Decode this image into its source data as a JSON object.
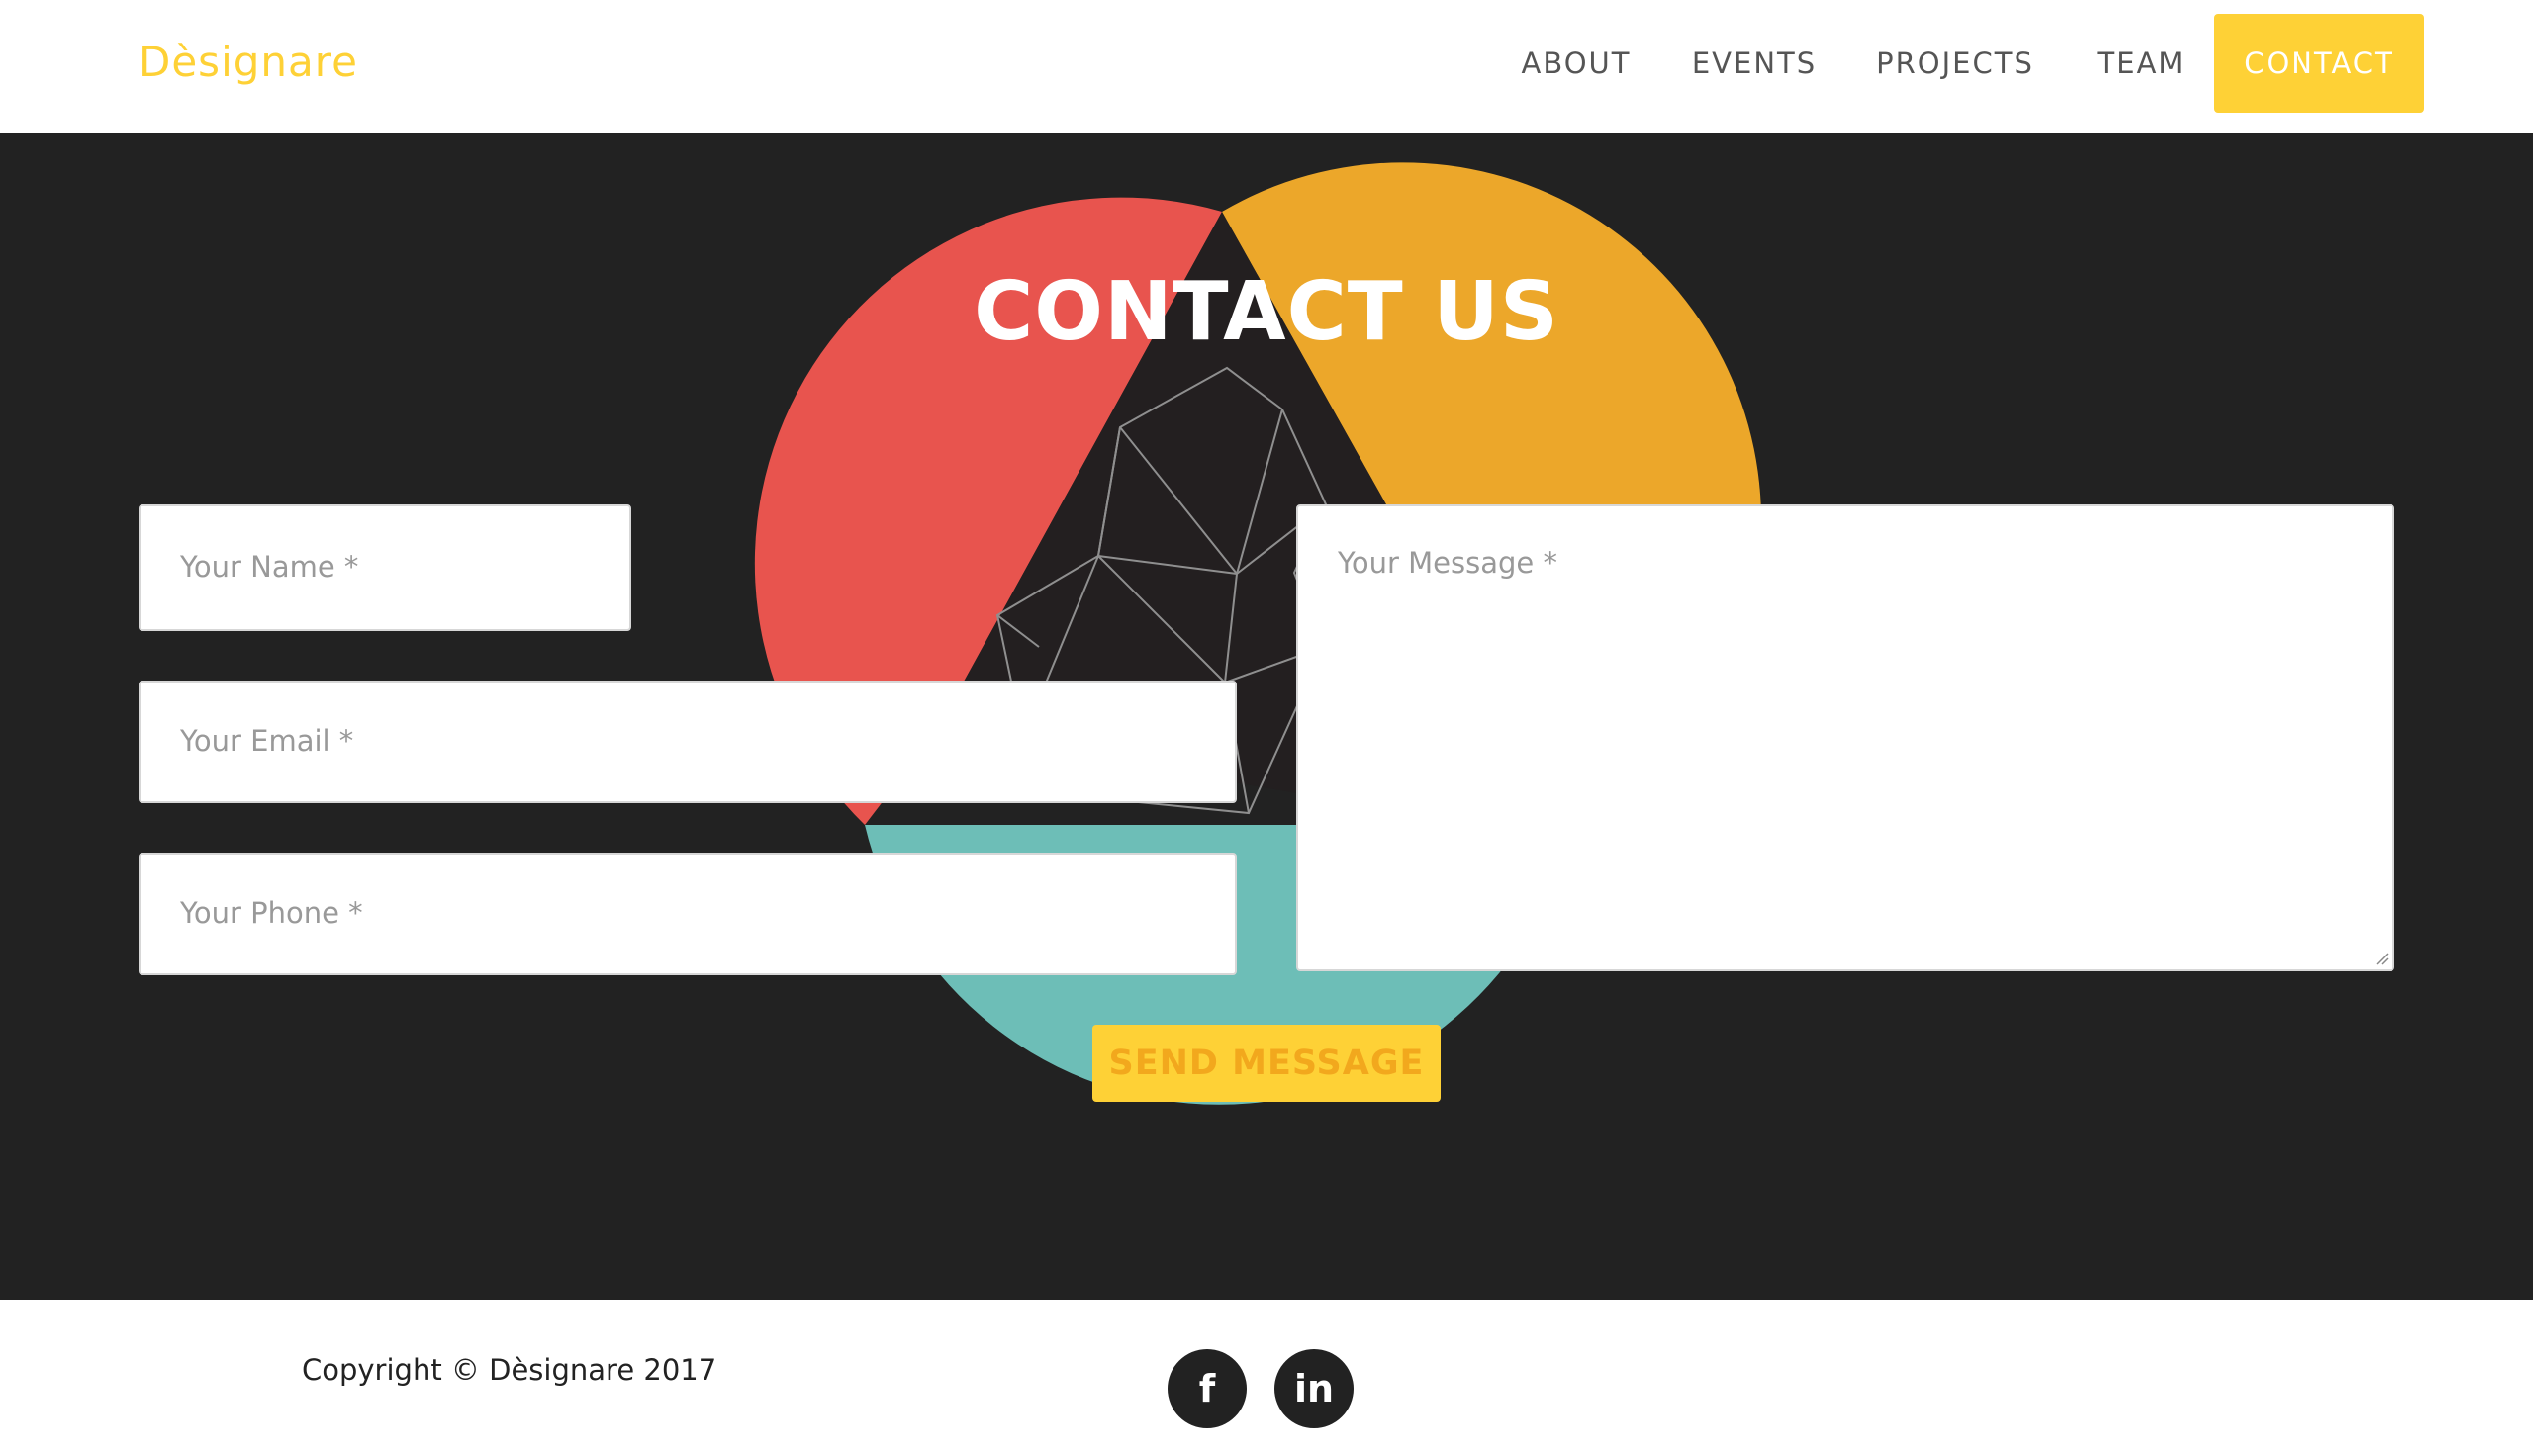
{
  "colors": {
    "accent": "#fed136",
    "dark_bg": "#222222",
    "red": "#e8544e",
    "orange": "#eca72a",
    "teal": "#6dbeb7"
  },
  "navbar": {
    "brand": "Dèsignare",
    "links": [
      {
        "label": "ABOUT"
      },
      {
        "label": "EVENTS"
      },
      {
        "label": "PROJECTS"
      },
      {
        "label": "TEAM"
      },
      {
        "label": "CONTACT",
        "active": true
      }
    ]
  },
  "contact": {
    "title": "CONTACT US",
    "form": {
      "name_placeholder": "Your Name *",
      "email_placeholder": "Your Email *",
      "phone_placeholder": "Your Phone *",
      "message_placeholder": "Your Message *",
      "submit_label": "SEND MESSAGE"
    }
  },
  "footer": {
    "copyright": "Copyright © Dèsignare 2017",
    "social": [
      {
        "icon": "facebook-icon",
        "glyph": "f"
      },
      {
        "icon": "linkedin-icon",
        "glyph": "in"
      }
    ]
  }
}
